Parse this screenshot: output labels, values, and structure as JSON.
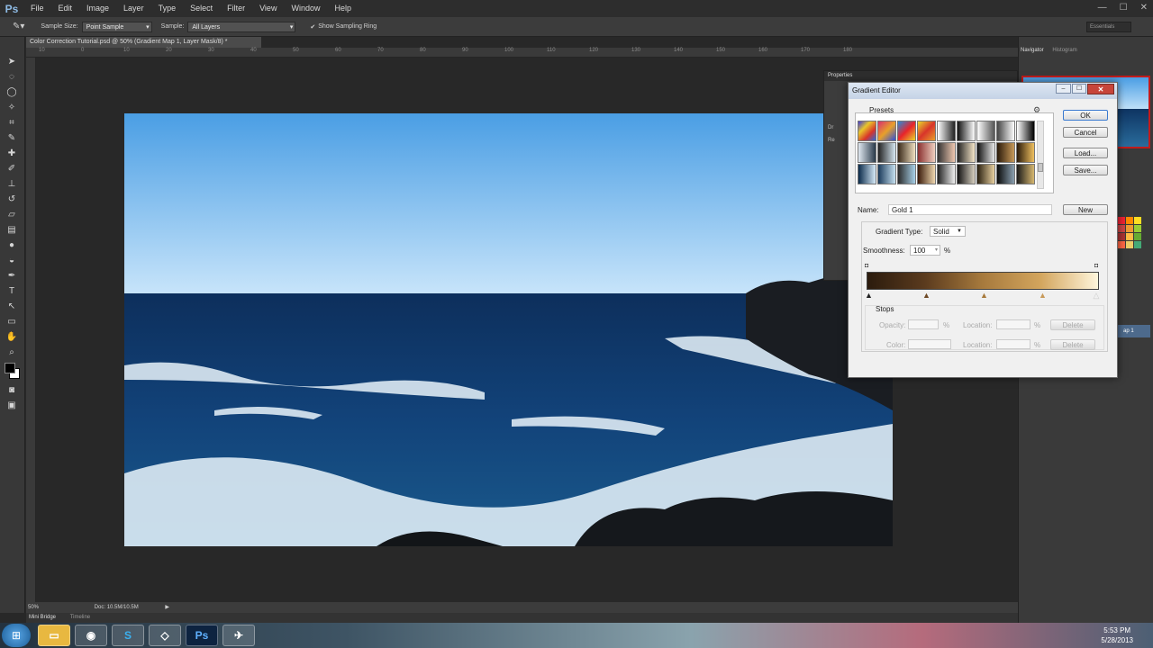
{
  "app": {
    "logo": "Ps",
    "menu": [
      "File",
      "Edit",
      "Image",
      "Layer",
      "Type",
      "Select",
      "Filter",
      "View",
      "Window",
      "Help"
    ],
    "window_controls": [
      "—",
      "☐",
      "✕"
    ]
  },
  "options": {
    "sample_size_label": "Sample Size:",
    "sample_size_value": "Point Sample",
    "sample_label": "Sample:",
    "sample_value": "All Layers",
    "show_ring": "Show Sampling Ring",
    "workspace": "Essentials"
  },
  "document": {
    "tab": "Color Correction Tutorial.psd @ 50% (Gradient Map 1, Layer Mask/8) *",
    "zoom": "50%",
    "doc_size": "Doc: 10.5M/10.5M",
    "ruler_marks": [
      "10",
      "0",
      "10",
      "20",
      "30",
      "40",
      "50",
      "60",
      "70",
      "80",
      "90",
      "100",
      "110",
      "120",
      "130",
      "140",
      "150",
      "160",
      "170",
      "180",
      "190"
    ]
  },
  "bottom_tabs": [
    "Mini Bridge",
    "Timeline"
  ],
  "panels": {
    "navigator_tab": "Navigator",
    "histogram_tab": "Histogram",
    "properties_title": "Properties",
    "props_items": [
      "Dr",
      "Re"
    ],
    "layer_label": "ap 1"
  },
  "gradient_editor": {
    "title": "Gradient Editor",
    "presets_label": "Presets",
    "buttons": {
      "ok": "OK",
      "cancel": "Cancel",
      "load": "Load...",
      "save": "Save...",
      "new": "New"
    },
    "name_label": "Name:",
    "name_value": "Gold 1",
    "type_label": "Gradient Type:",
    "type_value": "Solid",
    "smoothness_label": "Smoothness:",
    "smoothness_value": "100",
    "percent": "%",
    "stops_label": "Stops",
    "opacity_label": "Opacity:",
    "color_label": "Color:",
    "location_label": "Location:",
    "delete_label": "Delete",
    "gradient_colors": [
      "#2b1b0d",
      "#5b3b1e",
      "#a77a3d",
      "#d3a55d",
      "#fff6dc"
    ]
  },
  "taskbar": {
    "clock_time": "5:53 PM",
    "clock_date": "5/28/2013",
    "apps": [
      "folder",
      "chrome",
      "skype",
      "app",
      "Ps",
      "app2"
    ]
  }
}
